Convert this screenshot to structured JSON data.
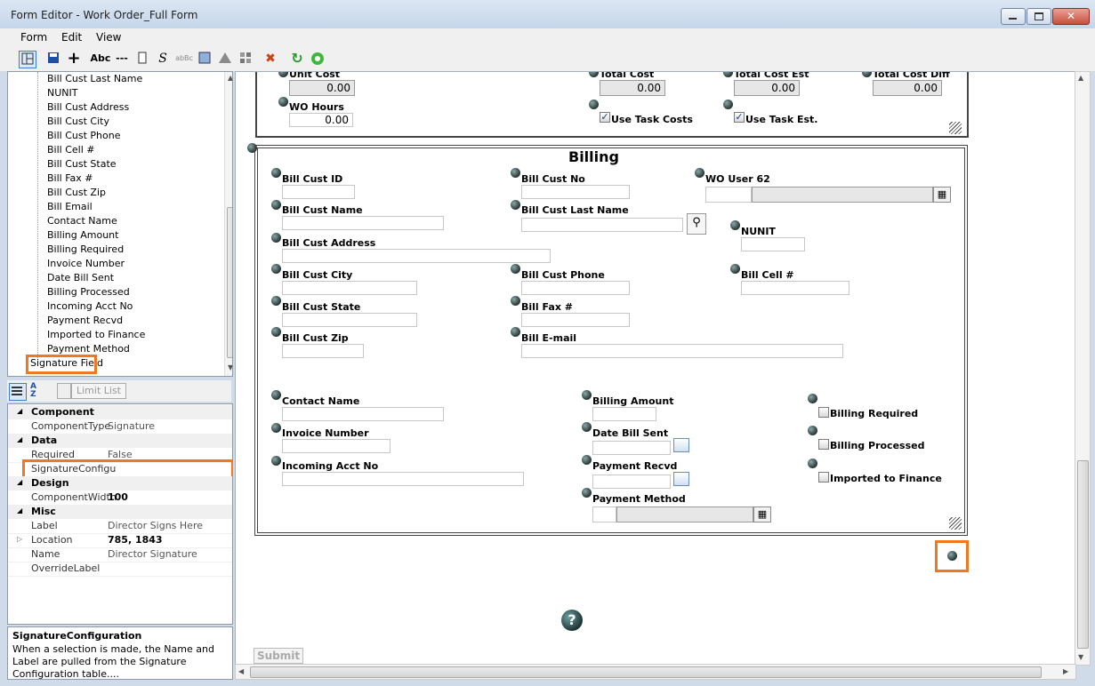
{
  "window": {
    "title": "Form Editor - Work Order_Full Form"
  },
  "menu": [
    "Form",
    "Edit",
    "View"
  ],
  "toolbar": {
    "abc": "Abc",
    "dash": "---",
    "script": "S",
    "abc_small": "abBc"
  },
  "tree": {
    "items": [
      "Bill Cust Last Name",
      "NUNIT",
      "Bill Cust Address",
      "Bill Cust City",
      "Bill Cust Phone",
      "Bill Cell #",
      "Bill Cust State",
      "Bill Fax #",
      "Bill Cust Zip",
      "Bill Email",
      "Contact Name",
      "Billing Amount",
      "Billing Required",
      "Invoice Number",
      "Date Bill Sent",
      "Billing Processed",
      "Incoming Acct No",
      "Payment Recvd",
      "Imported to Finance",
      "Payment Method"
    ],
    "selected": "Signature Field"
  },
  "propbar": {
    "limit_list": "Limit List"
  },
  "properties": {
    "component": {
      "header": "Component",
      "type_key": "ComponentType",
      "type_val": "Signature"
    },
    "data": {
      "header": "Data",
      "required_key": "Required",
      "required_val": "False",
      "sigconf_key": "SignatureConfigu"
    },
    "design": {
      "header": "Design",
      "width_key": "ComponentWidth",
      "width_val": "100"
    },
    "misc": {
      "header": "Misc",
      "label_key": "Label",
      "label_val": "Director Signs Here",
      "location_key": "Location",
      "location_val": "785, 1843",
      "name_key": "Name",
      "name_val": "Director Signature",
      "override_key": "OverrideLabel"
    }
  },
  "description": {
    "title": "SignatureConfiguration",
    "text": "When a selection is made, the Name and Label are pulled from the Signature Configuration table...."
  },
  "costs": {
    "unit_cost": "Unit Cost",
    "unit_cost_val": "0.00",
    "total_cost": "Total Cost",
    "total_cost_val": "0.00",
    "total_cost_est": "Total Cost Est",
    "total_cost_est_val": "0.00",
    "total_cost_diff": "Total Cost Diff",
    "total_cost_diff_val": "0.00",
    "wo_hours": "WO Hours",
    "wo_hours_val": "0.00",
    "use_task_costs": "Use Task Costs",
    "use_task_est": "Use Task Est."
  },
  "billing": {
    "title": "Billing",
    "bill_cust_id": "Bill Cust ID",
    "bill_cust_no": "Bill Cust No",
    "wo_user_62": "WO User 62",
    "bill_cust_name": "Bill Cust Name",
    "bill_cust_last_name": "Bill Cust Last Name",
    "nunit": "NUNIT",
    "bill_cust_address": "Bill Cust Address",
    "bill_cust_city": "Bill Cust City",
    "bill_cust_phone": "Bill Cust Phone",
    "bill_cell": "Bill Cell #",
    "bill_cust_state": "Bill Cust State",
    "bill_fax": "Bill Fax #",
    "bill_cust_zip": "Bill Cust Zip",
    "bill_email": "Bill E-mail",
    "contact_name": "Contact Name",
    "billing_amount": "Billing Amount",
    "billing_required": "Billing Required",
    "invoice_number": "Invoice Number",
    "date_bill_sent": "Date Bill Sent",
    "billing_processed": "Billing Processed",
    "incoming_acct_no": "Incoming Acct No",
    "payment_recvd": "Payment Recvd",
    "imported_to_finance": "Imported to Finance",
    "payment_method": "Payment Method"
  },
  "help_glyph": "?",
  "submit": "Submit",
  "colors": {
    "highlight": "#f07820",
    "window_bg": "#cfdbe8"
  }
}
